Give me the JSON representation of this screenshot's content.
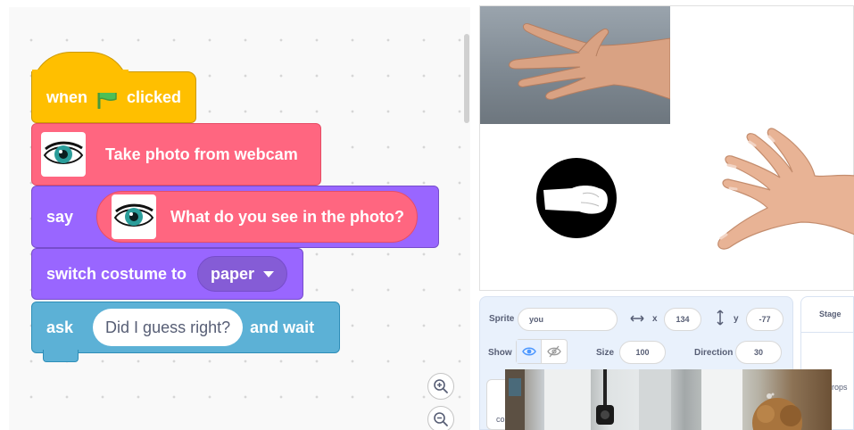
{
  "blocks": {
    "hat": {
      "word_when": "when",
      "word_clicked": "clicked"
    },
    "webcam": {
      "label": "Take photo from webcam"
    },
    "say": {
      "label": "say",
      "reporter_text": "What do you see in the photo?"
    },
    "switch_costume": {
      "label": "switch costume to",
      "value": "paper"
    },
    "ask": {
      "label": "ask",
      "input": "Did I guess right?",
      "suffix": "and wait"
    }
  },
  "sprite_info": {
    "sprite_label": "Sprite",
    "sprite_name": "you",
    "x_label": "x",
    "x_value": "134",
    "y_label": "y",
    "y_value": "-77",
    "show_label": "Show",
    "size_label": "Size",
    "size_value": "100",
    "direction_label": "Direction",
    "direction_value": "30"
  },
  "stage_pane": {
    "title": "Stage",
    "backdrops_partial": "rops"
  },
  "sprite_tile": {
    "label_partial": "co"
  },
  "colors": {
    "events": "#ffbf00",
    "extension": "#ff6680",
    "looks": "#9966ff",
    "sensing": "#5cb1d6",
    "text_dark": "#575e75",
    "accent_blue": "#4c97ff"
  },
  "icons": [
    "green-flag-icon",
    "eye-icon",
    "zoom-in-icon",
    "zoom-out-icon",
    "x-arrow-icon",
    "y-arrow-icon",
    "eye-show-icon",
    "eye-hide-icon"
  ]
}
